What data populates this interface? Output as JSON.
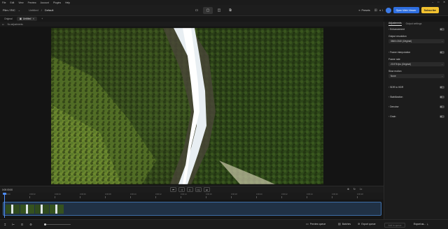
{
  "menu": {
    "items": [
      "File",
      "Edit",
      "View",
      "Preview",
      "Account",
      "Plugins",
      "Help"
    ]
  },
  "topbar": {
    "project": "Film / R/C",
    "breadcrumb_sep": "/",
    "workspace": "Untitled",
    "section": "Default",
    "presets_label": "Presets",
    "user_count": "1",
    "open_button": "Open Web Viewer",
    "upgrade_button": "Subscribe"
  },
  "tabs": {
    "items": [
      "Original",
      "Untitled"
    ],
    "active_index": 1,
    "add_symbol": "+"
  },
  "subbar": {
    "label": "No adjustments"
  },
  "panel": {
    "tabs": [
      "Adjustments",
      "Output settings"
    ],
    "sections": [
      {
        "label": "Enhancement",
        "toggle_on": false
      },
      {
        "label": "Output resolution",
        "value": "3840×2160 (Original)",
        "has_toggle": false
      },
      {
        "label": "Frame interpolation",
        "toggle_on": false
      },
      {
        "label": "Frame rate",
        "value": "23.976 fps (Original)",
        "has_toggle": false
      },
      {
        "label": "Slow motion",
        "value": "None",
        "has_toggle": false
      },
      {
        "label": "SDR to HDR",
        "toggle_on": false
      },
      {
        "label": "Stabilization",
        "toggle_on": false
      },
      {
        "label": "Denoise",
        "toggle_on": false
      },
      {
        "label": "Grain",
        "toggle_on": false
      }
    ]
  },
  "timeline": {
    "label": "0:00:00:00",
    "fps_label": "1x",
    "ruler_ticks": [
      "0:00:00",
      "0:00:02",
      "0:00:04",
      "0:00:06",
      "0:00:08",
      "0:00:10",
      "0:00:12",
      "0:00:14",
      "0:00:16",
      "0:00:18",
      "0:00:20",
      "0:00:22",
      "0:00:24",
      "0:00:26",
      "0:00:28"
    ]
  },
  "bottom": {
    "preview_queue": "Preview queue",
    "batches": "Batches",
    "export_queue": "Export queue",
    "add_to_queue": "Add to queue",
    "export_as": "Export as..."
  },
  "colors": {
    "accent_blue": "#2f6fe0",
    "accent_yellow": "#f2c230",
    "toggle_on": "#4e8df5"
  },
  "icons": [
    "sidebar-icon",
    "compare-icon",
    "split-view-icon",
    "fullscreen-icon",
    "presets-icon",
    "grid-icon",
    "skip-back-icon",
    "step-back-icon",
    "play-icon",
    "step-forward-icon",
    "skip-forward-icon",
    "loop-icon",
    "settings-icon",
    "export-icon"
  ]
}
